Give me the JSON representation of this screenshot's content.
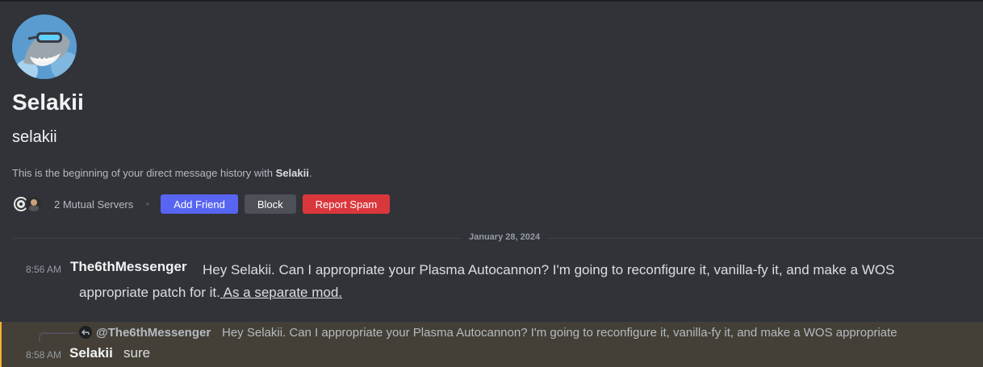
{
  "profile": {
    "display_name": "Selakii",
    "username": "selakii"
  },
  "intro": {
    "prefix": "This is the beginning of your direct message history with ",
    "name": "Selakii",
    "suffix": "."
  },
  "actions": {
    "mutual_servers": "2 Mutual Servers",
    "add_friend": "Add Friend",
    "block": "Block",
    "report_spam": "Report Spam"
  },
  "divider": {
    "date": "January 28, 2024"
  },
  "messages": [
    {
      "time": "8:56 AM",
      "author": "The6thMessenger",
      "text": "Hey Selakii. Can I appropriate your Plasma Autocannon? I'm going to reconfigure it, vanilla-fy it, and make a WOS appropriate patch for it.",
      "link_text": " As a separate mod."
    },
    {
      "time": "8:58 AM",
      "author": "Selakii",
      "text": "sure",
      "reply": {
        "author": "@The6thMessenger",
        "preview": "Hey Selakii. Can I appropriate your Plasma Autocannon? I'm going to reconfigure it, vanilla-fy it, and make a WOS appropriate"
      }
    }
  ],
  "colors": {
    "background": "#313338",
    "primary_button": "#5865f2",
    "secondary_button": "#4e5058",
    "danger_button": "#da373c",
    "mention_highlight": "#444037",
    "mention_bar": "#f0b232"
  }
}
